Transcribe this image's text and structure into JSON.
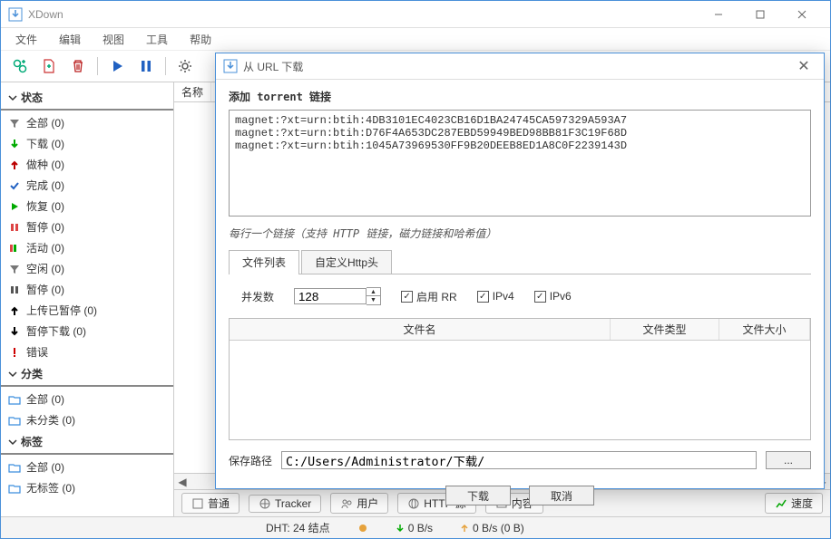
{
  "app": {
    "title": "XDown"
  },
  "menu": {
    "file": "文件",
    "edit": "编辑",
    "view": "视图",
    "tools": "工具",
    "help": "帮助"
  },
  "icons": {
    "add": "add-url-icon",
    "newfile": "new-file-icon",
    "delete": "trash-icon",
    "play": "play-icon",
    "pause": "pause-icon",
    "settings": "gear-icon",
    "lock": "lock-icon"
  },
  "sidebar": {
    "status": {
      "header": "状态",
      "items": [
        {
          "icon": "filter",
          "color": "#777",
          "label": "全部 (0)"
        },
        {
          "icon": "down",
          "color": "#0a0",
          "label": "下载 (0)"
        },
        {
          "icon": "up",
          "color": "#b00",
          "label": "做种 (0)"
        },
        {
          "icon": "check",
          "color": "#2161c2",
          "label": "完成 (0)"
        },
        {
          "icon": "play",
          "color": "#0a0",
          "label": "恢复 (0)"
        },
        {
          "icon": "pause",
          "color": "#d44",
          "label": "暂停 (0)"
        },
        {
          "icon": "dot",
          "color": "#d44",
          "label": "活动 (0)"
        },
        {
          "icon": "filter",
          "color": "#777",
          "label": "空闲 (0)"
        },
        {
          "icon": "pause",
          "color": "#555",
          "label": "暂停 (0)"
        },
        {
          "icon": "up",
          "color": "#000",
          "label": "上传已暂停 (0)"
        },
        {
          "icon": "down",
          "color": "#000",
          "label": "暂停下载 (0)"
        },
        {
          "icon": "excl",
          "color": "#c00",
          "label": "错误"
        }
      ]
    },
    "category": {
      "header": "分类",
      "items": [
        {
          "icon": "folder",
          "color": "#3a8dde",
          "label": "全部 (0)"
        },
        {
          "icon": "folder",
          "color": "#3a8dde",
          "label": "未分类 (0)"
        }
      ]
    },
    "tags": {
      "header": "标签",
      "items": [
        {
          "icon": "folder",
          "color": "#3a8dde",
          "label": "全部 (0)"
        },
        {
          "icon": "folder",
          "color": "#3a8dde",
          "label": "无标签 (0)"
        }
      ]
    }
  },
  "list": {
    "col_name": "名称"
  },
  "bottom_tabs": {
    "normal": "普通",
    "tracker": "Tracker",
    "peers": "用户",
    "http": "HTTP 源",
    "content": "内容",
    "speed": "速度"
  },
  "status": {
    "dht": "DHT: 24 结点",
    "down": "0 B/s",
    "up": "0 B/s (0 B)"
  },
  "dialog": {
    "title": "从 URL 下载",
    "heading": "添加 torrent 链接",
    "text": "magnet:?xt=urn:btih:4DB3101EC4023CB16D1BA24745CA597329A593A7\nmagnet:?xt=urn:btih:D76F4A653DC287EBD59949BED98BB81F3C19F68D\nmagnet:?xt=urn:btih:1045A73969530FF9B20DEEB8ED1A8C0F2239143D",
    "hint": "每行一个链接（支持 HTTP 链接，磁力链接和哈希值）",
    "tab_filelist": "文件列表",
    "tab_httphdr": "自定义Http头",
    "concurrency_label": "并发数",
    "concurrency_value": "128",
    "enable_rr": "启用 RR",
    "ipv4": "IPv4",
    "ipv6": "IPv6",
    "cols": {
      "name": "文件名",
      "type": "文件类型",
      "size": "文件大小"
    },
    "path_label": "保存路径",
    "path_value": "C:/Users/Administrator/下载/",
    "browse": "...",
    "download_btn": "下载",
    "cancel_btn": "取消"
  }
}
